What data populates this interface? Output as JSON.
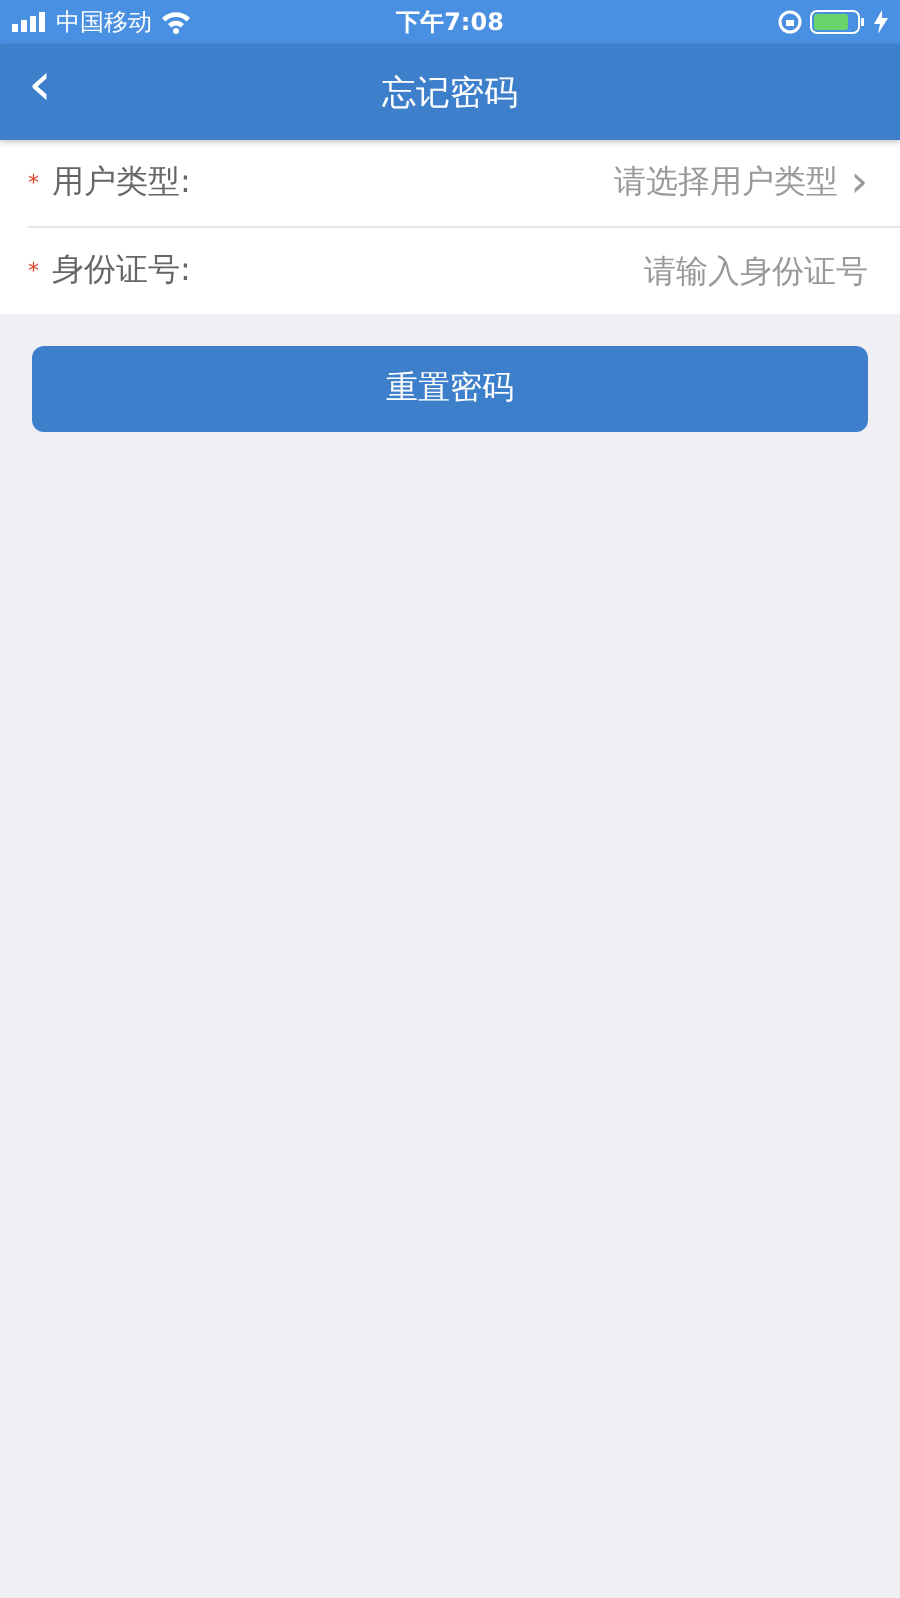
{
  "status_bar": {
    "carrier": "中国移动",
    "time": "下午7:08"
  },
  "nav": {
    "back": "‹",
    "title": "忘记密码"
  },
  "fields": [
    {
      "kind": "select",
      "required_mark": "*",
      "label": "用户类型:",
      "placeholder": "请选择用户类型",
      "chevron": "›"
    },
    {
      "kind": "input",
      "required_mark": "*",
      "label": "身份证号:",
      "placeholder": "请输入身份证号"
    }
  ],
  "button": "重置密码"
}
